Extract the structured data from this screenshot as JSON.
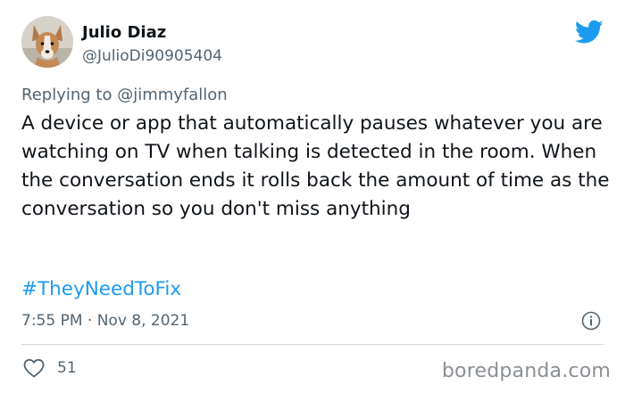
{
  "tweet": {
    "author_name": "Julio Diaz",
    "author_handle": "@JulioDi90905404",
    "replying_to_prefix": "Replying to ",
    "replying_to_handle": "@jimmyfallon",
    "body": "A device or app that automatically pauses whatever you are watching on TV when talking is detected in the room. When the conversation ends it rolls back the amount of time as the conversation so you don't miss anything",
    "hashtag": "#TheyNeedToFix",
    "timestamp": "7:55 PM · Nov 8, 2021",
    "like_count": "51"
  },
  "icons": {
    "brand": "twitter-bird-icon",
    "info": "info-icon",
    "like": "heart-icon"
  },
  "colors": {
    "accent": "#1d9bf0",
    "secondary_text": "#536471",
    "primary_text": "#0f1419",
    "divider": "#cfd9de",
    "watermark": "#8a8f94"
  },
  "watermark": "boredpanda.com"
}
